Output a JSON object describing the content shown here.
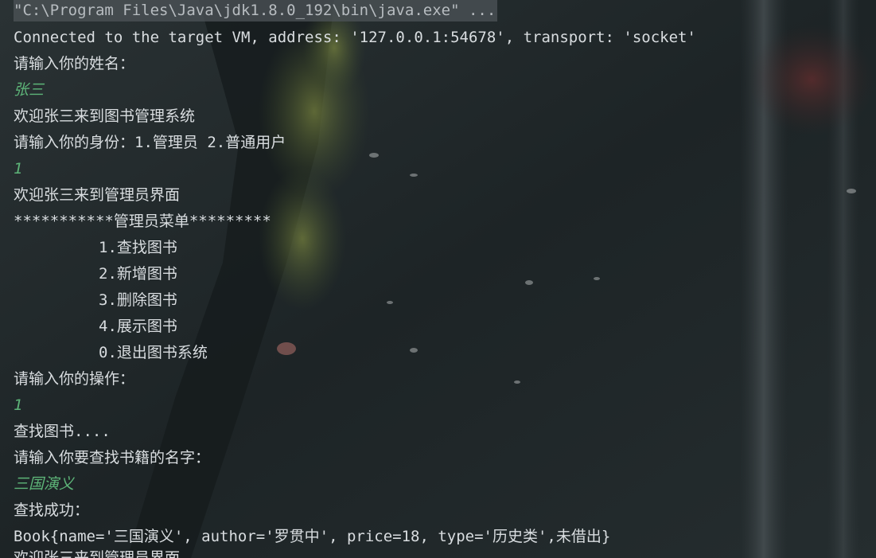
{
  "colors": {
    "background": "#1f2527",
    "text": "#d9dde0",
    "input_echo": "#5db478",
    "command_bar": "#4e5458"
  },
  "console": {
    "command": "\"C:\\Program Files\\Java\\jdk1.8.0_192\\bin\\java.exe\" ...",
    "connected": "Connected to the target VM, address: '127.0.0.1:54678', transport: 'socket'",
    "prompt_name": "请输入你的姓名：",
    "input_name": "张三",
    "welcome_system": "欢迎张三来到图书管理系统",
    "prompt_role": "请输入你的身份：1.管理员 2.普通用户",
    "input_role": "1",
    "welcome_admin": "欢迎张三来到管理员界面",
    "menu_header": "***********管理员菜单*********",
    "menu_items": [
      "1.查找图书",
      "2.新增图书",
      "3.删除图书",
      "4.展示图书",
      "0.退出图书系统"
    ],
    "prompt_operation": "请输入你的操作：",
    "input_operation": "1",
    "finding_book": "查找图书....",
    "prompt_book_name": "请输入你要查找书籍的名字：",
    "input_book_name": "三国演义",
    "find_success": "查找成功：",
    "book_result": "Book{name='三国演义', author='罗贯中', price=18, type='历史类',未借出}",
    "next_line_partial": "欢迎张三来到管理员界面"
  }
}
